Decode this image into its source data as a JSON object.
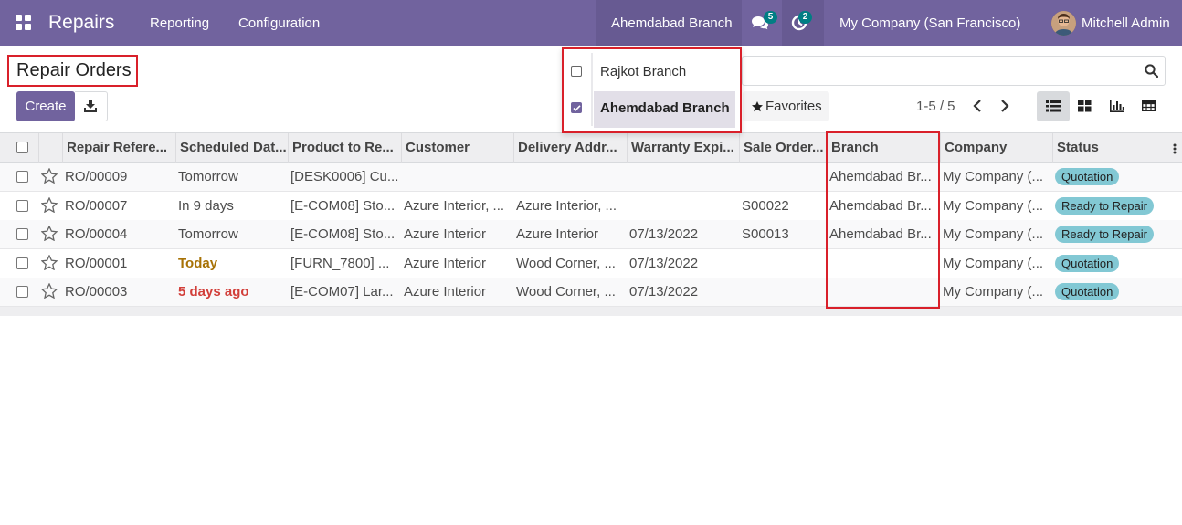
{
  "navbar": {
    "app_name": "Repairs",
    "menus": [
      "Reporting",
      "Configuration"
    ],
    "branch": "Ahemdabad Branch",
    "messages_count": "5",
    "activities_count": "2",
    "company": "My Company (San Francisco)",
    "user": "Mitchell Admin",
    "accent_color": "#71639e"
  },
  "control_panel": {
    "title": "Repair Orders",
    "create_label": "Create",
    "favorites_label": "Favorites",
    "pager": "1-5 / 5"
  },
  "branch_dropdown": {
    "items": [
      {
        "label": "Rajkot Branch",
        "checked": false
      },
      {
        "label": "Ahemdabad Branch",
        "checked": true
      }
    ]
  },
  "table": {
    "columns": [
      "Repair Refere...",
      "Scheduled Dat...",
      "Product to Re...",
      "Customer",
      "Delivery Addr...",
      "Warranty Expi...",
      "Sale Order...",
      "Branch",
      "Company",
      "Status"
    ],
    "rows": [
      {
        "ref": "RO/00009",
        "sched": "Tomorrow",
        "sched_style": "normal",
        "product": "[DESK0006] Cu...",
        "customer": "",
        "delivery": "",
        "warranty": "",
        "sale_order": "",
        "branch": "Ahemdabad Br...",
        "company": "My Company (...",
        "status": "Quotation"
      },
      {
        "ref": "RO/00007",
        "sched": "In 9 days",
        "sched_style": "normal",
        "product": "[E-COM08] Sto...",
        "customer": "Azure Interior, ...",
        "delivery": "Azure Interior, ...",
        "warranty": "",
        "sale_order": "S00022",
        "branch": "Ahemdabad Br...",
        "company": "My Company (...",
        "status": "Ready to Repair"
      },
      {
        "ref": "RO/00004",
        "sched": "Tomorrow",
        "sched_style": "normal",
        "product": "[E-COM08] Sto...",
        "customer": "Azure Interior",
        "delivery": "Azure Interior",
        "warranty": "07/13/2022",
        "sale_order": "S00013",
        "branch": "Ahemdabad Br...",
        "company": "My Company (...",
        "status": "Ready to Repair"
      },
      {
        "ref": "RO/00001",
        "sched": "Today",
        "sched_style": "today",
        "product": "[FURN_7800] ...",
        "customer": "Azure Interior",
        "delivery": "Wood Corner, ...",
        "warranty": "07/13/2022",
        "sale_order": "",
        "branch": "",
        "company": "My Company (...",
        "status": "Quotation"
      },
      {
        "ref": "RO/00003",
        "sched": "5 days ago",
        "sched_style": "late",
        "product": "[E-COM07] Lar...",
        "customer": "Azure Interior",
        "delivery": "Wood Corner, ...",
        "warranty": "07/13/2022",
        "sale_order": "",
        "branch": "",
        "company": "My Company (...",
        "status": "Quotation"
      }
    ]
  }
}
